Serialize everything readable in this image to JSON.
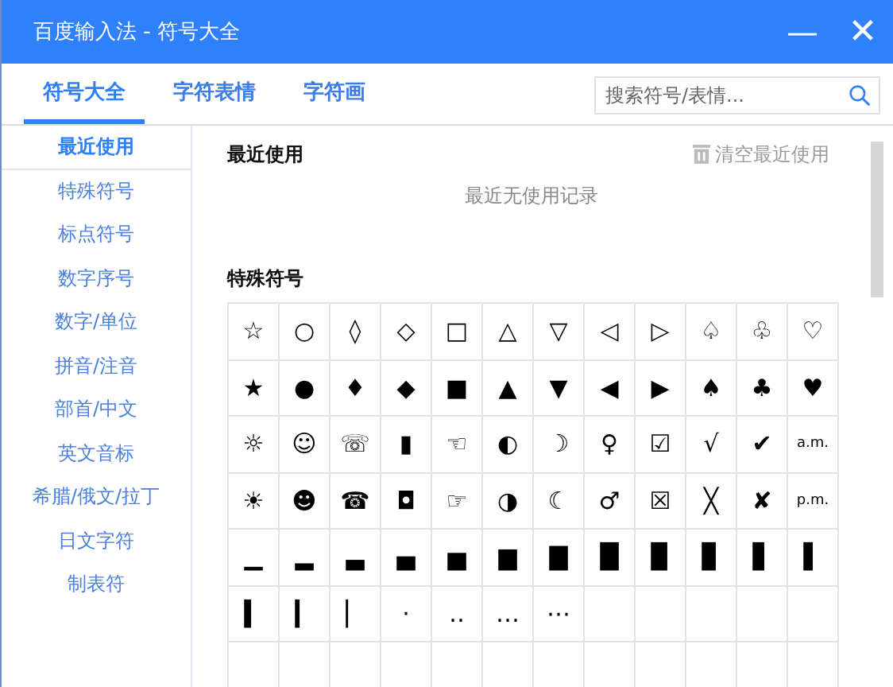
{
  "window": {
    "title": "百度输入法 - 符号大全",
    "minimize": "—",
    "close": "✕"
  },
  "tabs": [
    {
      "label": "符号大全",
      "selected": true
    },
    {
      "label": "字符表情",
      "selected": false
    },
    {
      "label": "字符画",
      "selected": false
    }
  ],
  "search": {
    "placeholder": "搜索符号/表情..."
  },
  "sidebar": {
    "items": [
      {
        "label": "最近使用",
        "selected": true
      },
      {
        "label": "特殊符号",
        "selected": false
      },
      {
        "label": "标点符号",
        "selected": false
      },
      {
        "label": "数字序号",
        "selected": false
      },
      {
        "label": "数字/单位",
        "selected": false
      },
      {
        "label": "拼音/注音",
        "selected": false
      },
      {
        "label": "部首/中文",
        "selected": false
      },
      {
        "label": "英文音标",
        "selected": false
      },
      {
        "label": "希腊/俄文/拉丁",
        "selected": false
      },
      {
        "label": "日文字符",
        "selected": false
      },
      {
        "label": "制表符",
        "selected": false
      }
    ]
  },
  "recent": {
    "heading": "最近使用",
    "clear_button": "清空最近使用",
    "empty_message": "最近无使用记录"
  },
  "special": {
    "heading": "特殊符号",
    "rows": [
      [
        "☆",
        "○",
        "◊",
        "◇",
        "□",
        "△",
        "▽",
        "◁",
        "▷",
        "♤",
        "♧",
        "♡"
      ],
      [
        "★",
        "●",
        "♦",
        "◆",
        "■",
        "▲",
        "▼",
        "◀",
        "▶",
        "♠",
        "♣",
        "♥"
      ],
      [
        "☼",
        "☺",
        "☏",
        "▮",
        "☜",
        "◐",
        "☽",
        "♀",
        "☑",
        "√",
        "✔",
        "a.m."
      ],
      [
        "☀",
        "☻",
        "☎",
        "◘",
        "☞",
        "◑",
        "☾",
        "♂",
        "☒",
        "╳",
        "✘",
        "p.m."
      ],
      [
        "▁",
        "▂",
        "▃",
        "▄",
        "▅",
        "▆",
        "▇",
        "█",
        "▉",
        "▊",
        "▋",
        "▌"
      ],
      [
        "▍",
        "▎",
        "▏",
        "·",
        "‥",
        "…",
        "⋯"
      ]
    ]
  }
}
